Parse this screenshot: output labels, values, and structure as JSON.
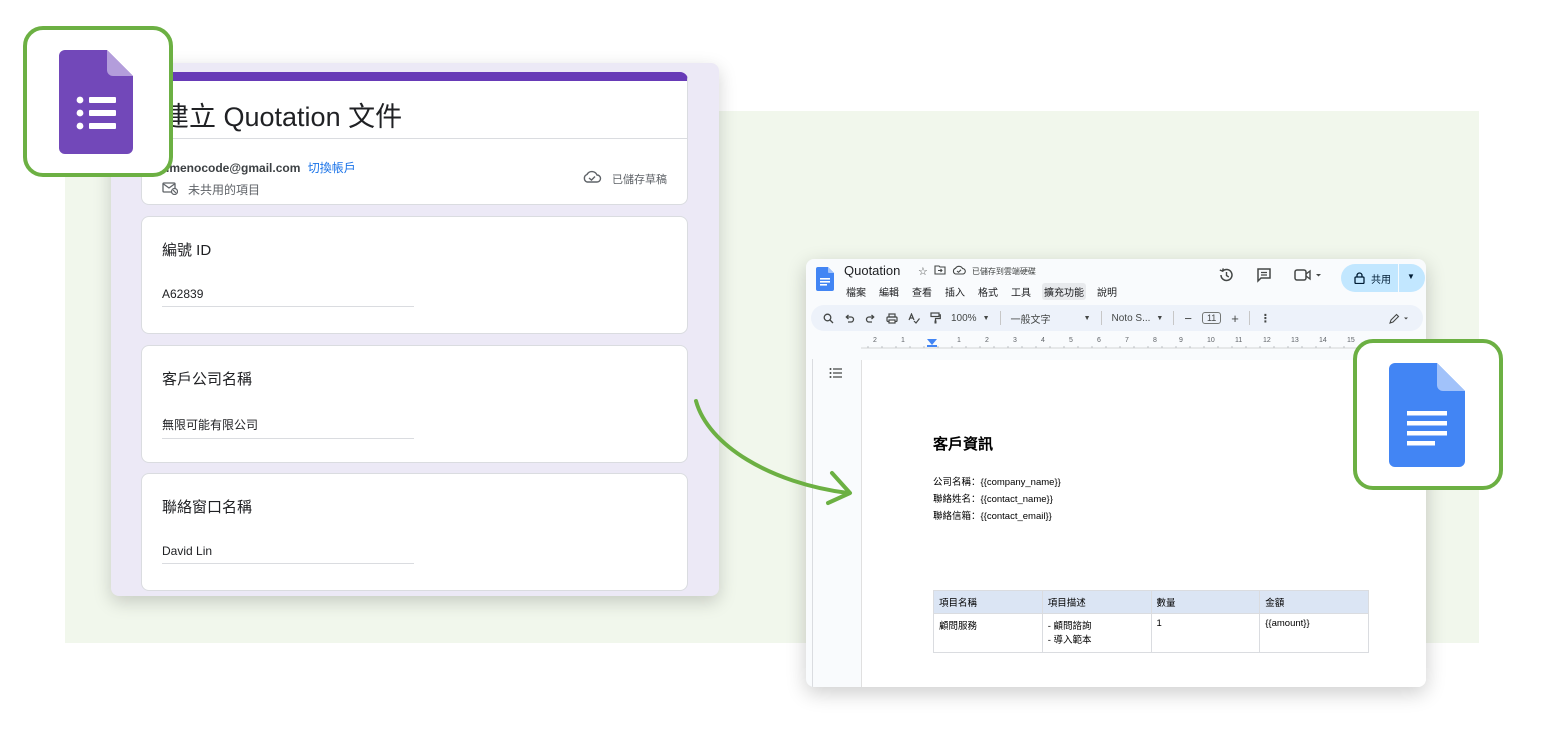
{
  "form": {
    "title": "建立 Quotation 文件",
    "account_email": "timenocode@gmail.com",
    "switch_account": "切換帳戶",
    "not_shared": "未共用的項目",
    "saved_status": "已儲存草稿",
    "accent_color": "#673ab7",
    "questions": [
      {
        "label": "編號 ID",
        "answer": "A62839"
      },
      {
        "label": "客戶公司名稱",
        "answer": "無限可能有限公司"
      },
      {
        "label": "聯絡窗口名稱",
        "answer": "David Lin"
      }
    ]
  },
  "badges": {
    "forms_icon": "google-forms-icon",
    "docs_icon": "google-docs-icon",
    "border_color": "#6cb043"
  },
  "docs": {
    "title": "Quotation",
    "saved_status": "已儲存到雲端硬碟",
    "menus": [
      "檔案",
      "編輯",
      "查看",
      "插入",
      "格式",
      "工具",
      "擴充功能",
      "說明"
    ],
    "active_menu": "擴充功能",
    "share_label": "共用",
    "toolbar": {
      "zoom": "100%",
      "style": "一般文字",
      "font": "Noto S...",
      "font_size": "11"
    },
    "ruler": [
      "2",
      "1",
      "1",
      "2",
      "3",
      "4",
      "5",
      "6",
      "7",
      "8",
      "9",
      "10",
      "11",
      "12",
      "13",
      "14",
      "15"
    ],
    "content": {
      "heading": "客戶資訊",
      "lines": [
        "公司名稱：{{company_name}}",
        "聯絡姓名：{{contact_name}}",
        "聯絡信箱：{{contact_email}}"
      ],
      "table": {
        "headers": [
          "項目名稱",
          "項目描述",
          "數量",
          "金額"
        ],
        "rows": [
          {
            "item": "顧問服務",
            "desc_1": "- 顧問諮詢",
            "desc_2": "- 導入範本",
            "qty": "1",
            "amount": "{{amount}}"
          }
        ]
      }
    }
  }
}
